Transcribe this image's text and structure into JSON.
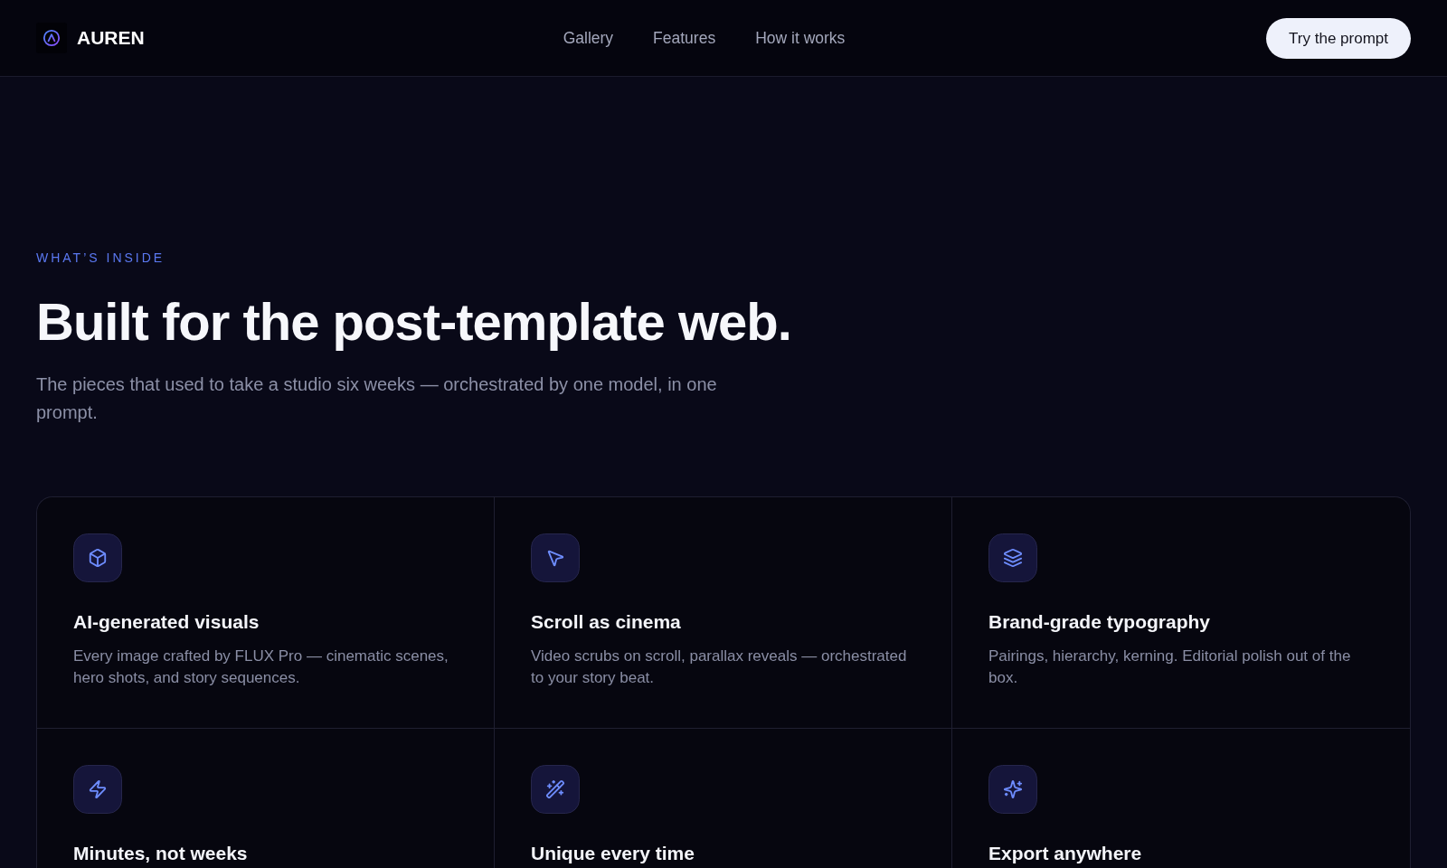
{
  "nav": {
    "brand": "AUREN",
    "links": [
      "Gallery",
      "Features",
      "How it works"
    ],
    "cta": "Try the prompt"
  },
  "intro": {
    "eyebrow": "WHAT’S INSIDE",
    "title": "Built for the post-template web.",
    "subtitle": "The pieces that used to take a studio six weeks — orchestrated by one model, in one prompt."
  },
  "features": [
    {
      "title": "AI-generated visuals",
      "description": "Every image crafted by FLUX Pro — cinematic scenes, hero shots, and story sequences."
    },
    {
      "title": "Scroll as cinema",
      "description": "Video scrubs on scroll, parallax reveals — orchestrated to your story beat."
    },
    {
      "title": "Brand-grade typography",
      "description": "Pairings, hierarchy, kerning. Editorial polish out of the box."
    },
    {
      "title": "Minutes, not weeks"
    },
    {
      "title": "Unique every time"
    },
    {
      "title": "Export anywhere"
    }
  ]
}
